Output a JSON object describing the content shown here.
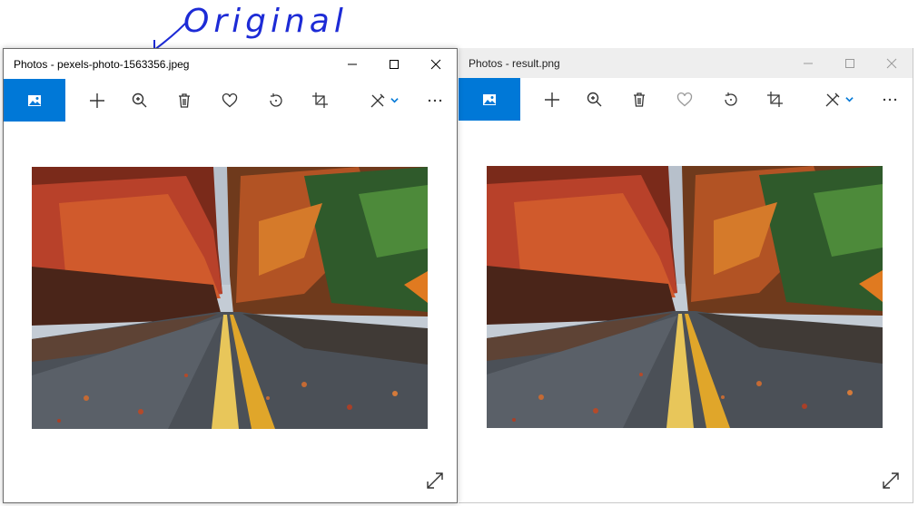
{
  "annotation": {
    "text": "Original",
    "color": "#1d2bd6"
  },
  "windows": [
    {
      "title": "Photos - pexels-photo-1563356.jpeg",
      "active": true,
      "toolbar": [
        "view-icon",
        "add-icon",
        "zoom-icon",
        "delete-icon",
        "favorite-icon",
        "rotate-icon",
        "crop-icon",
        "edit-draw-icon",
        "more-icon"
      ]
    },
    {
      "title": "Photos - result.png",
      "active": false,
      "toolbar": [
        "view-icon",
        "add-icon",
        "zoom-icon",
        "delete-icon",
        "favorite-icon",
        "rotate-icon",
        "crop-icon",
        "edit-draw-icon",
        "more-icon"
      ]
    }
  ],
  "colors": {
    "accent": "#0078d7",
    "inactive_titlebar": "#eeeeee"
  },
  "image": {
    "subject": "autumn road photo"
  }
}
